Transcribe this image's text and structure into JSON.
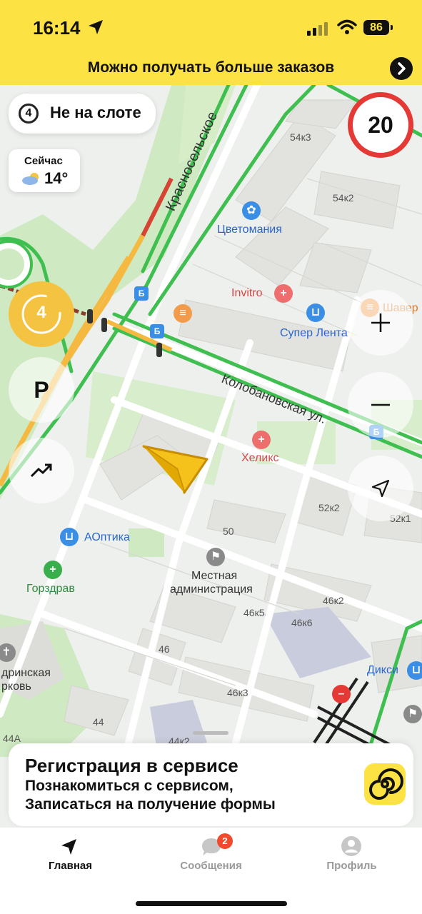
{
  "status_bar": {
    "time": "16:14",
    "battery": "86"
  },
  "promo": {
    "text": "Можно получать больше заказов"
  },
  "slot": {
    "count": "4",
    "label": "Не на слоте"
  },
  "weather": {
    "label": "Сейчас",
    "temp": "14°"
  },
  "speed_limit": "20",
  "rank_badge": "4",
  "parking_label": "P",
  "map": {
    "streets": [
      "Красносельское",
      "Колобановская ул."
    ],
    "places": {
      "cvetomania": "Цветомания",
      "invitro": "Invitro",
      "super_lenta": "Супер Лента",
      "shaverma": "Шавер",
      "heliks": "Хеликс",
      "aoptika": "АОптика",
      "gorzdrav": "Горздрав",
      "admin_line1": "Местная",
      "admin_line2": "администрация",
      "church_line1": "дринская",
      "church_line2": "рковь",
      "dixy": "Дикси"
    },
    "buildings": [
      "54к3",
      "54к2",
      "52к2",
      "52к1",
      "50",
      "46к2",
      "46к5",
      "46к6",
      "46",
      "46к3",
      "44",
      "44А",
      "44к2"
    ]
  },
  "registration_card": {
    "title": "Регистрация в сервисе",
    "line1": "Познакомиться с сервисом,",
    "line2": "Записаться на получение формы"
  },
  "tabs": [
    {
      "label": "Главная",
      "icon": "navigation-arrow-icon",
      "active": true
    },
    {
      "label": "Сообщения",
      "icon": "chat-bubble-icon",
      "badge": "2"
    },
    {
      "label": "Профиль",
      "icon": "profile-icon"
    }
  ]
}
